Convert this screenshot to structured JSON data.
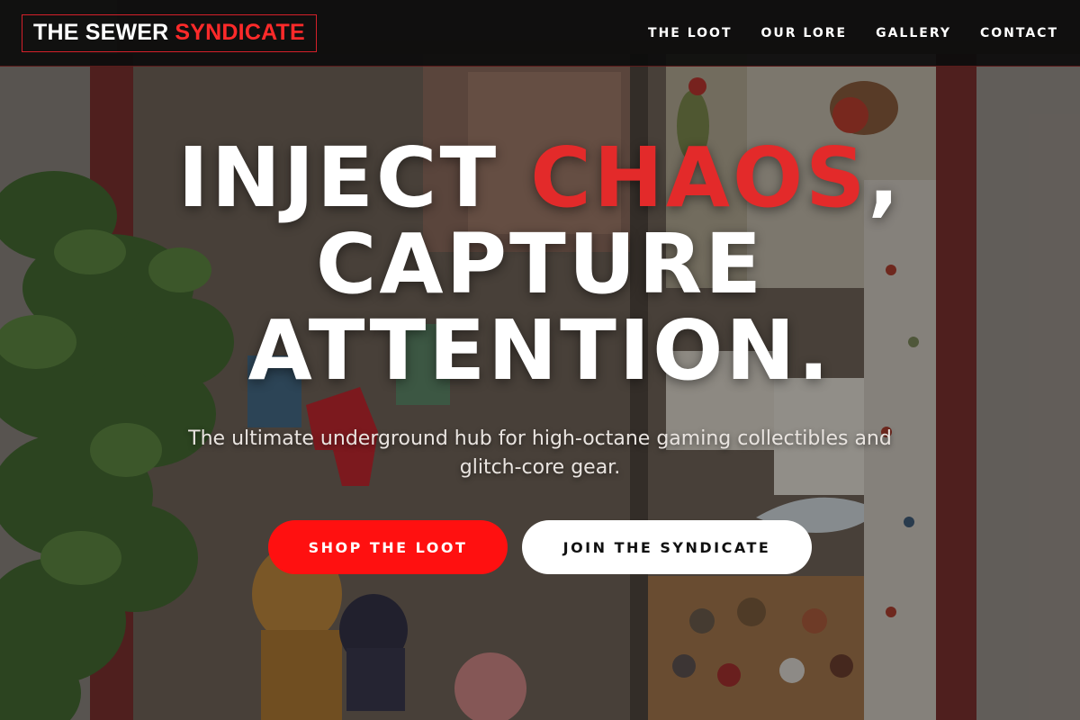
{
  "brand": {
    "name_primary": "THE SEWER",
    "name_accent": "SYNDICATE",
    "accent_color": "#ff2a2a"
  },
  "nav": {
    "items": [
      {
        "label": "THE LOOT"
      },
      {
        "label": "OUR LORE"
      },
      {
        "label": "GALLERY"
      },
      {
        "label": "CONTACT"
      }
    ]
  },
  "hero": {
    "headline_part1": "INJECT ",
    "headline_accent": "CHAOS",
    "headline_part2": ",",
    "headline_line2": "CAPTURE",
    "headline_line3": "ATTENTION.",
    "subtitle": "The ultimate underground hub for high-octane gaming collectibles and glitch-core gear.",
    "primary_cta": "SHOP THE LOOT",
    "secondary_cta": "JOIN THE SYNDICATE",
    "background": "shop-window-photo"
  },
  "colors": {
    "primary_red": "#ff1010",
    "headline_red": "#e32a2a",
    "nav_bg": "#0c0c0c"
  }
}
